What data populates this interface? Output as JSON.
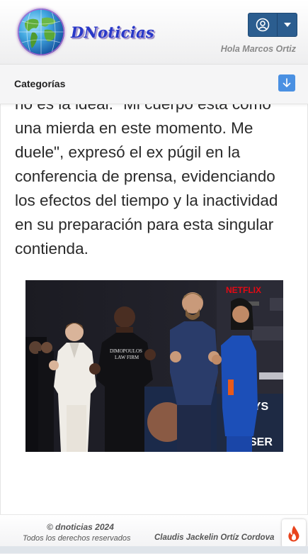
{
  "header": {
    "logo_text": "DNoticias",
    "greeting": "Hola Marcos Ortiz",
    "user_icon": "user-circle-icon",
    "menu_icon": "caret-down-icon"
  },
  "categories": {
    "label": "Categorías",
    "toggle_icon": "arrow-down-icon"
  },
  "article": {
    "text": "no es la ideal. \"Mi cuerpo está como una mierda en este momento. Me duele\", expresó el ex púgil en la conferencia de prensa, evidenciando los efectos del tiempo y la inactividad en su preparación para esta singular contienda."
  },
  "photo": {
    "sponsor_mark": "NETFLIX",
    "shirt_text_line1": "DIMOPOULOS",
    "shirt_text_line2": "LAW FIRM",
    "poster_text_1": "TYS",
    "poster_text_2": "SER"
  },
  "footer": {
    "copyright": "© dnoticias 2024",
    "rights": "Todos los derechos reservados",
    "author": "Claudis Jackelin Ortíz Cordova"
  },
  "colors": {
    "brand_blue": "#2838c8",
    "button_blue": "#2b5d8f",
    "category_button": "#4a90e2"
  }
}
